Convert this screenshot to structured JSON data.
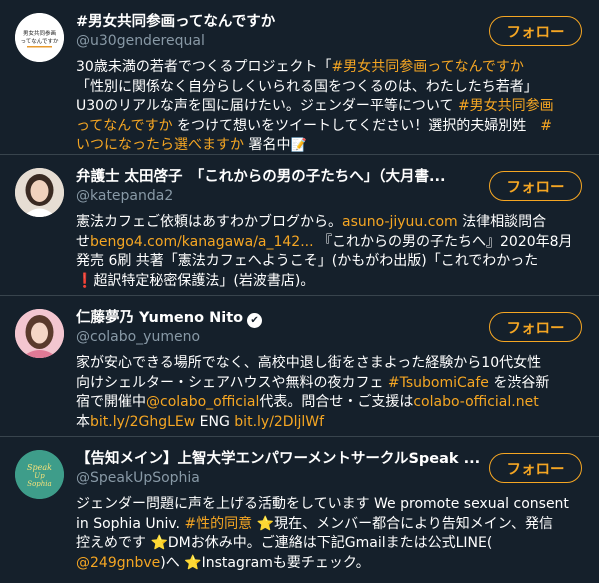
{
  "follow_label": "フォロー",
  "accounts": [
    {
      "name": "#男女共同参画ってなんですか",
      "handle": "@u30genderequal",
      "avatar_text": "男女共同参画ってなんですか",
      "bio": {
        "l1a": "30歳未満の若者でつくるプロジェクト「",
        "l1b": "#男女共同参画ってなんですか",
        "l2": "「性別に関係なく自分らしくいられる国をつくるのは、わたしたち若者」",
        "l3a": "U30のリアルな声を国に届けたい。ジェンダー平等について ",
        "l3b": "#男女共同参画",
        "l4a": "ってなんですか",
        "l4b": " をつけて想いをツイートしてください！選択的夫婦別姓　",
        "l4c": "#",
        "l5a": "いつになったら選べますか",
        "l5b": " 署名中",
        "l5c": "📝"
      }
    },
    {
      "name": "弁護士 太田啓子　「これからの男の子たちへ」（大月書...",
      "handle": "@katepanda2",
      "bio": {
        "l1a": "憲法カフェご依頼はあすわかブログから。",
        "l1b": "asuno-jiyuu.com",
        "l1c": " 法律相談問合",
        "l2a": "せ",
        "l2b": "bengo4.com/kanagawa/a_142...",
        "l2c": " 『これからの男の子たちへ』2020年8月",
        "l3": "発売 6刷 共著「憲法カフェへようこそ」(かもがわ出版)「これでわかった",
        "l4a": "❗",
        "l4b": "超訳特定秘密保護法」(岩波書店)。"
      }
    },
    {
      "name": "仁藤夢乃 Yumeno Nito",
      "handle": "@colabo_yumeno",
      "verified_icon": "✔",
      "bio": {
        "l1": "家が安心できる場所でなく、高校中退し街をさまよった経験から10代女性",
        "l2a": "向けシェルター・シェアハウスや無料の夜カフェ ",
        "l2b": "#TsubomiCafe",
        "l2c": " を渋谷新",
        "l3a": "宿で開催中",
        "l3b": "@colabo_official",
        "l3c": "代表。問合せ・ご支援は",
        "l3d": "colabo-official.net",
        "l4a": "本",
        "l4b": "bit.ly/2GhgLEw",
        "l4c": " ENG ",
        "l4d": "bit.ly/2DljlWf"
      }
    },
    {
      "name": "【告知メイン】上智大学エンパワーメントサークルSpeak ...",
      "handle": "@SpeakUpSophia",
      "avatar_text": "Speak Up Sophia",
      "bio": {
        "l1": "ジェンダー問題に声を上げる活動をしています We promote sexual consent",
        "l2a": "in Sophia Univ. ",
        "l2b": "#性的同意",
        "l2c": " ⭐",
        "l2d": "現在、メンバー都合により告知メイン、発信",
        "l3a": "控えめです ",
        "l3b": "⭐",
        "l3c": "DMお休み中。ご連絡は下記Gmailまたは公式LINE(",
        "l4a": "@249gnbve",
        "l4b": ")へ ",
        "l4c": "⭐",
        "l4d": "Instagramも要チェック。"
      }
    }
  ]
}
